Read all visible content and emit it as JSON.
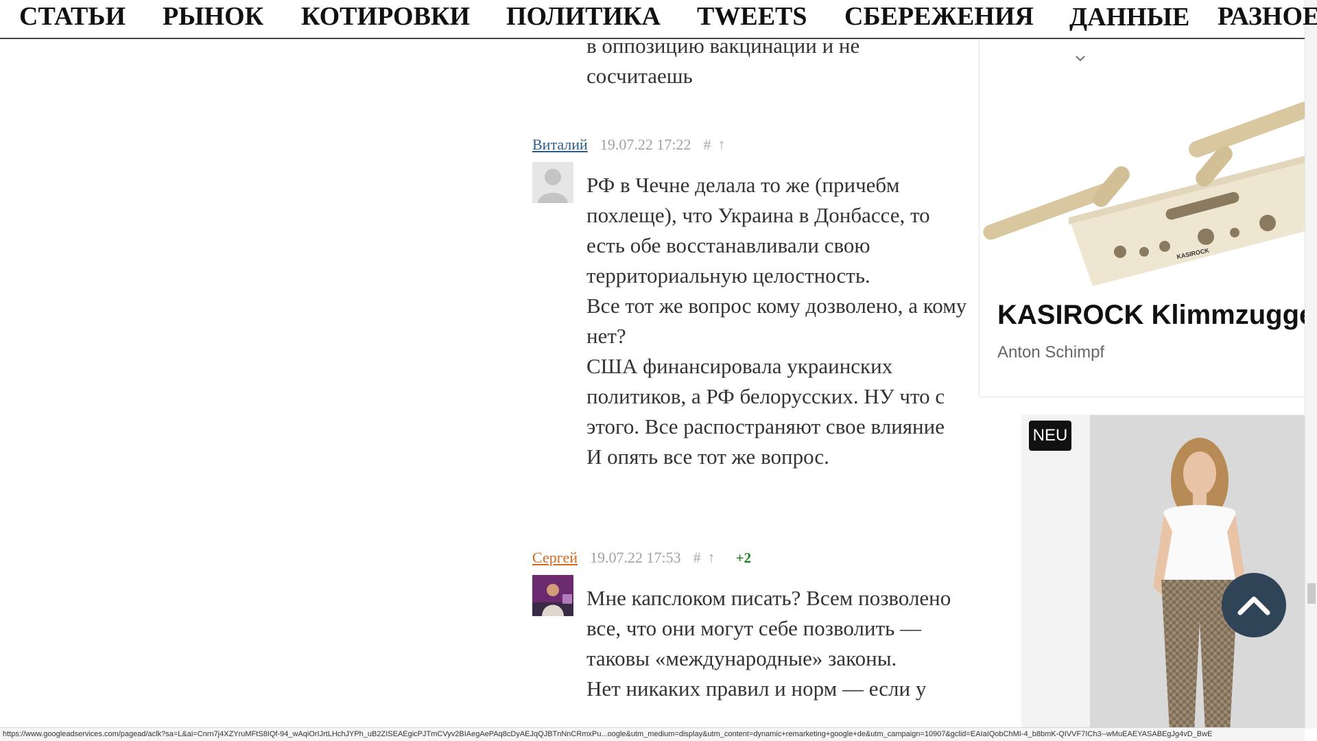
{
  "nav": {
    "items": [
      "СТАТЬИ",
      "РЫНОК",
      "КОТИРОВКИ",
      "ПОЛИТИКА",
      "TWEETS",
      "СБЕРЕЖЕНИЯ",
      "ДАННЫЕ",
      "РАЗНОЕ"
    ]
  },
  "previous_comment": {
    "lines": [
      "в оппозицию вакцинации и не",
      "сосчитаешь"
    ]
  },
  "comments": [
    {
      "author": "Виталий",
      "author_color": "#2b5d8a",
      "date": "19.07.22 17:22",
      "hash": "#",
      "arrow": "↑",
      "rating": "",
      "avatar": "default-avatar",
      "paragraphs": [
        "РФ в Чечне делала то же (причебм похлеще), что Украина в Донбассе, то есть обе восстанавливали свою территориальную целостность.",
        "Все тот же вопрос кому дозволено, а кому нет?",
        "США финансировала украинских политиков, а РФ белорусских. НУ что с этого. Все распостраняют свое влияние",
        "И опять все тот же вопрос."
      ]
    },
    {
      "author": "Сергей",
      "author_color": "#d2691e",
      "date": "19.07.22 17:53",
      "hash": "#",
      "arrow": "↑",
      "rating": "+2",
      "avatar": "user-photo",
      "paragraphs": [
        "Мне капслоком писать? Всем позволено все, что они могут себе позволить — таковы «международные» законы.",
        "Нет никаких правил и норм — если у"
      ]
    }
  ],
  "ads": {
    "card1": {
      "title": "KASIROCK Klimmzugger",
      "source": "Anton Schimpf",
      "logo": "KASIROCK"
    },
    "card2": {
      "badge": "NEU"
    }
  },
  "status_url": "https://www.googleadservices.com/pagead/aclk?sa=L&ai=Cnrn7j4XZYruMFtS8IQf-94_wAqiOrIJrtLHchJYPh_uB2ZISEAEgicPJTmCVyv2BIAegAePAq8cDyAEJqQJBTnNnCRmxPu...oogle&utm_medium=display&utm_content=dynamic+remarketing+google+de&utm_campaign=10907&gclid=EAIaIQobChMI-4_b8bmK-QIVVF7ICh3--wMuEAEYASABEgJg4vD_BwE",
  "colors": {
    "accent_dark": "#2f4457",
    "rating_green": "#1a8a1a"
  }
}
